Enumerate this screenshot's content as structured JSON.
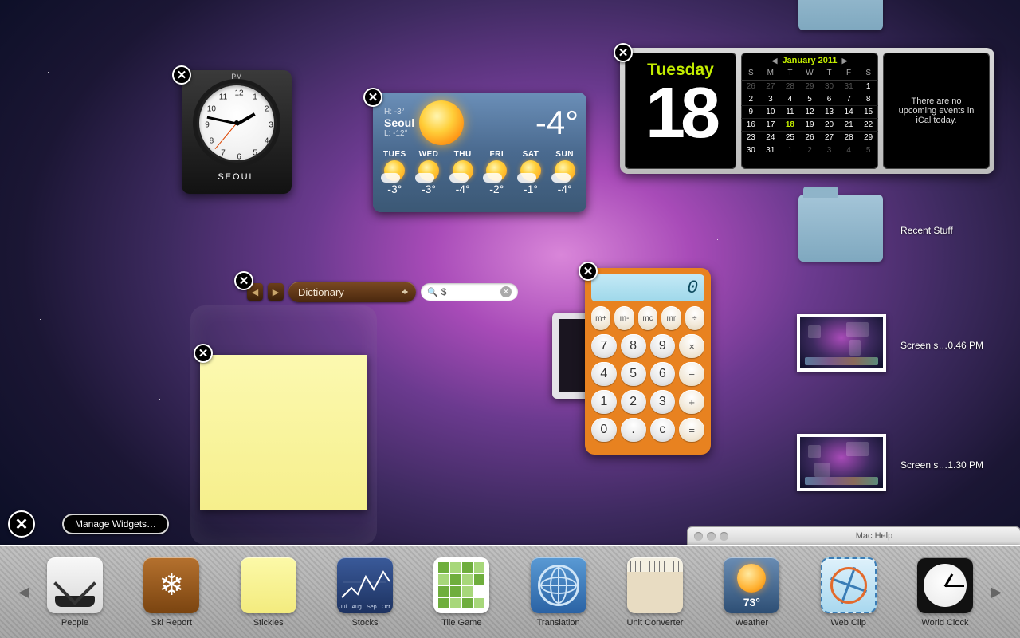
{
  "clock": {
    "ampm": "PM",
    "city": "SEOUL",
    "numbers": [
      "12",
      "1",
      "2",
      "3",
      "4",
      "5",
      "6",
      "7",
      "8",
      "9",
      "10",
      "11"
    ]
  },
  "weather": {
    "city": "Seoul",
    "hi": "H: -3°",
    "lo": "L: -12°",
    "current": "-4°",
    "days": [
      {
        "name": "TUES",
        "temp": "-3°"
      },
      {
        "name": "WED",
        "temp": "-3°"
      },
      {
        "name": "THU",
        "temp": "-4°"
      },
      {
        "name": "FRI",
        "temp": "-2°"
      },
      {
        "name": "SAT",
        "temp": "-1°"
      },
      {
        "name": "SUN",
        "temp": "-4°"
      }
    ]
  },
  "calendar": {
    "dow": "Tuesday",
    "daynum": "18",
    "month": "January 2011",
    "wk_hdr": [
      "S",
      "M",
      "T",
      "W",
      "T",
      "F",
      "S"
    ],
    "no_events": "There are no upcoming events in iCal today.",
    "grid": [
      [
        {
          "n": "26",
          "d": 1
        },
        {
          "n": "27",
          "d": 1
        },
        {
          "n": "28",
          "d": 1
        },
        {
          "n": "29",
          "d": 1
        },
        {
          "n": "30",
          "d": 1
        },
        {
          "n": "31",
          "d": 1
        },
        {
          "n": "1"
        }
      ],
      [
        {
          "n": "2"
        },
        {
          "n": "3"
        },
        {
          "n": "4"
        },
        {
          "n": "5"
        },
        {
          "n": "6"
        },
        {
          "n": "7"
        },
        {
          "n": "8"
        }
      ],
      [
        {
          "n": "9"
        },
        {
          "n": "10"
        },
        {
          "n": "11"
        },
        {
          "n": "12"
        },
        {
          "n": "13"
        },
        {
          "n": "14"
        },
        {
          "n": "15"
        }
      ],
      [
        {
          "n": "16"
        },
        {
          "n": "17"
        },
        {
          "n": "18",
          "t": 1
        },
        {
          "n": "19"
        },
        {
          "n": "20"
        },
        {
          "n": "21"
        },
        {
          "n": "22"
        }
      ],
      [
        {
          "n": "23"
        },
        {
          "n": "24"
        },
        {
          "n": "25"
        },
        {
          "n": "26"
        },
        {
          "n": "27"
        },
        {
          "n": "28"
        },
        {
          "n": "29"
        }
      ],
      [
        {
          "n": "30"
        },
        {
          "n": "31"
        },
        {
          "n": "1",
          "d": 1
        },
        {
          "n": "2",
          "d": 1
        },
        {
          "n": "3",
          "d": 1
        },
        {
          "n": "4",
          "d": 1
        },
        {
          "n": "5",
          "d": 1
        }
      ]
    ]
  },
  "dictionary": {
    "mode": "Dictionary",
    "query": "$"
  },
  "calculator": {
    "display": "0",
    "keys": [
      {
        "l": "m+",
        "c": "op"
      },
      {
        "l": "m-",
        "c": "op"
      },
      {
        "l": "mc",
        "c": "op"
      },
      {
        "l": "mr",
        "c": "op"
      },
      {
        "l": "÷",
        "c": "op"
      },
      {
        "l": "7",
        "c": "num"
      },
      {
        "l": "8",
        "c": "num"
      },
      {
        "l": "9",
        "c": "num"
      },
      {
        "l": "×",
        "c": "op"
      },
      {
        "l": "4",
        "c": "num"
      },
      {
        "l": "5",
        "c": "num"
      },
      {
        "l": "6",
        "c": "num"
      },
      {
        "l": "−",
        "c": "op"
      },
      {
        "l": "1",
        "c": "num"
      },
      {
        "l": "2",
        "c": "num"
      },
      {
        "l": "3",
        "c": "num"
      },
      {
        "l": "+",
        "c": "op"
      },
      {
        "l": "0",
        "c": "num"
      },
      {
        "l": ".",
        "c": "num"
      },
      {
        "l": "c",
        "c": "num"
      },
      {
        "l": "=",
        "c": "op"
      }
    ]
  },
  "desktop": {
    "folder_top_label": "",
    "recent_label": "Recent Stuff",
    "shot1": "Screen s…0.46 PM",
    "shot2": "Screen s…1.30 PM"
  },
  "machelp": {
    "title": "Mac Help"
  },
  "controls": {
    "manage": "Manage Widgets…"
  },
  "bar": {
    "items": [
      {
        "label": "People",
        "icon": "people"
      },
      {
        "label": "Ski Report",
        "icon": "ski"
      },
      {
        "label": "Stickies",
        "icon": "stick"
      },
      {
        "label": "Stocks",
        "icon": "stock"
      },
      {
        "label": "Tile Game",
        "icon": "tile"
      },
      {
        "label": "Translation",
        "icon": "trans"
      },
      {
        "label": "Unit Converter",
        "icon": "unit"
      },
      {
        "label": "Weather",
        "icon": "weath",
        "badge": "73°"
      },
      {
        "label": "Web Clip",
        "icon": "webc"
      },
      {
        "label": "World Clock",
        "icon": "wclk"
      }
    ]
  }
}
